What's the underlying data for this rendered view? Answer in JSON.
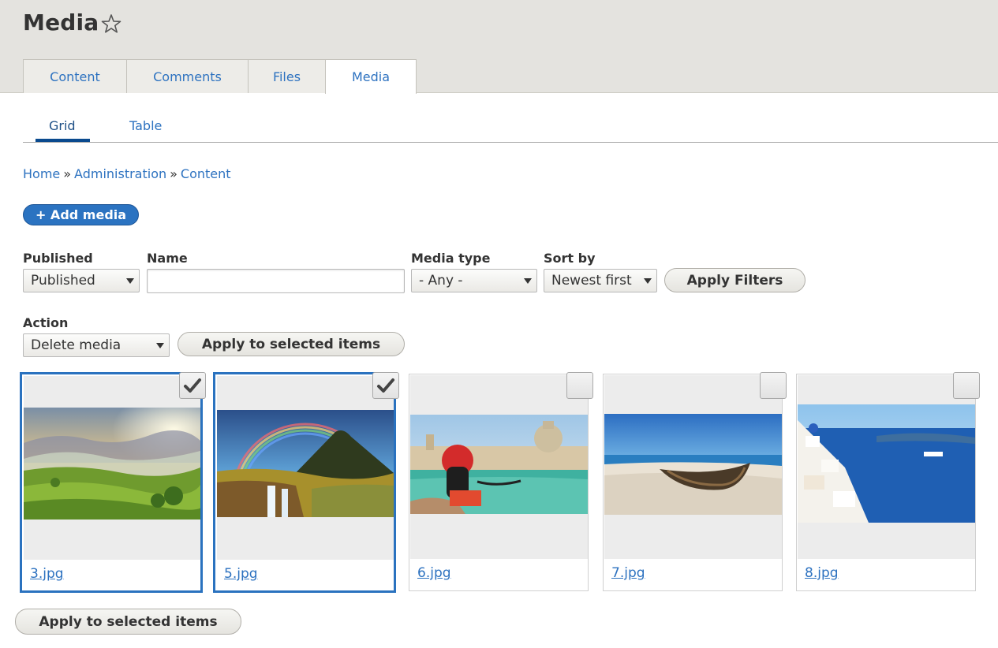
{
  "header": {
    "title": "Media",
    "tabs": [
      {
        "label": "Content"
      },
      {
        "label": "Comments"
      },
      {
        "label": "Files"
      },
      {
        "label": "Media"
      }
    ]
  },
  "subtabs": [
    {
      "label": "Grid"
    },
    {
      "label": "Table"
    }
  ],
  "breadcrumb": {
    "items": [
      "Home",
      "Administration",
      "Content"
    ],
    "separator": "»"
  },
  "add_media": {
    "label": "+ Add media"
  },
  "filters": {
    "published": {
      "label": "Published",
      "value": "Published"
    },
    "name": {
      "label": "Name",
      "value": ""
    },
    "media_type": {
      "label": "Media type",
      "value": "- Any -"
    },
    "sort_by": {
      "label": "Sort by",
      "value": "Newest first"
    },
    "apply_label": "Apply Filters"
  },
  "action": {
    "label": "Action",
    "value": "Delete media",
    "apply_label": "Apply to selected items"
  },
  "media_items": [
    {
      "filename": "3.jpg",
      "selected": true,
      "image": "landscape-hills"
    },
    {
      "filename": "5.jpg",
      "selected": true,
      "image": "rainbow-waterfall"
    },
    {
      "filename": "6.jpg",
      "selected": false,
      "image": "venice-canal"
    },
    {
      "filename": "7.jpg",
      "selected": false,
      "image": "beach-boat"
    },
    {
      "filename": "8.jpg",
      "selected": false,
      "image": "santorini"
    }
  ],
  "bottom_apply": {
    "label": "Apply to selected items"
  },
  "colors": {
    "link": "#2d72c0",
    "primary_button": "#2b73c1",
    "selected_border": "#2a72bf",
    "header_bg": "#e4e3df"
  },
  "icons": {
    "favorite": "star-outline-icon",
    "checked": "checkmark-icon",
    "dropdown": "caret-down-icon"
  }
}
